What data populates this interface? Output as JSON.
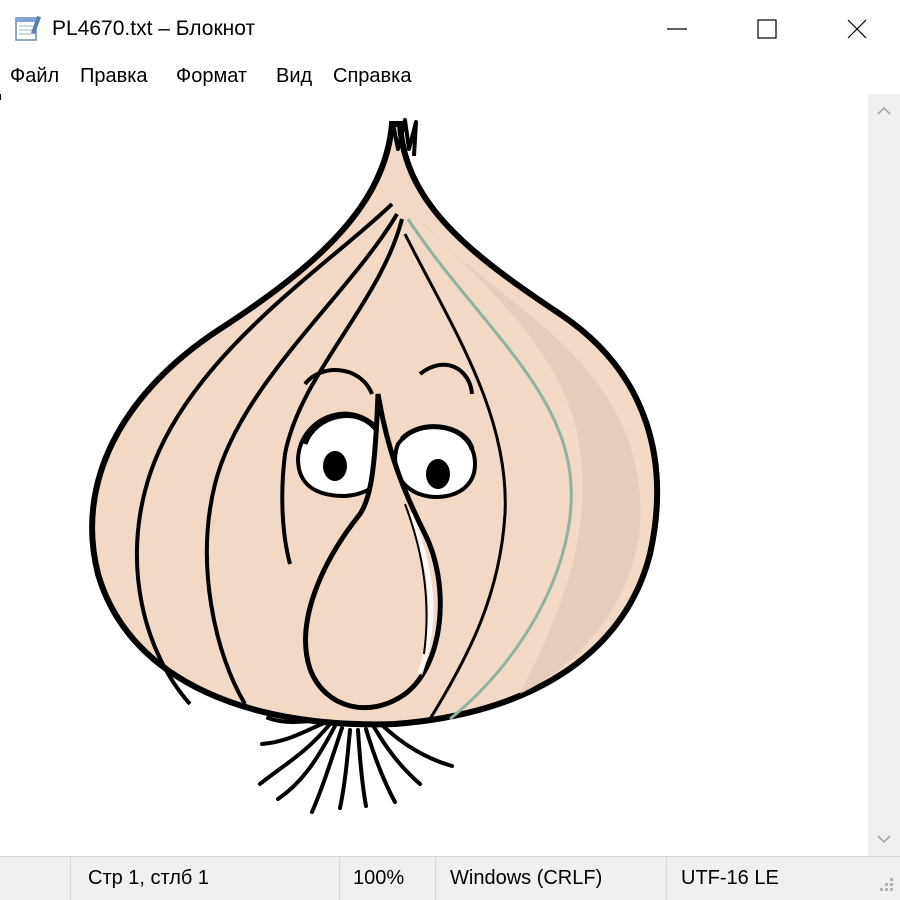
{
  "window": {
    "title": "PL4670.txt – Блокнот",
    "icon": "notepad-icon",
    "controls": [
      "minimize-icon",
      "maximize-icon",
      "close-icon"
    ]
  },
  "menu": {
    "items": [
      "Файл",
      "Правка",
      "Формат",
      "Вид",
      "Справка"
    ]
  },
  "editor": {
    "content_icon": "onion-character-drawing"
  },
  "status": {
    "position": "Стр 1, стлб 1",
    "zoom": "100%",
    "line_ending": "Windows (CRLF)",
    "encoding": "UTF-16 LE"
  },
  "colors": {
    "onion_fill": "#f1d9c6",
    "onion_shadow": "#e3cbbd",
    "outline": "#000000",
    "highlight": "#8fb3a3",
    "statusbar_bg": "#f0f0f0"
  }
}
